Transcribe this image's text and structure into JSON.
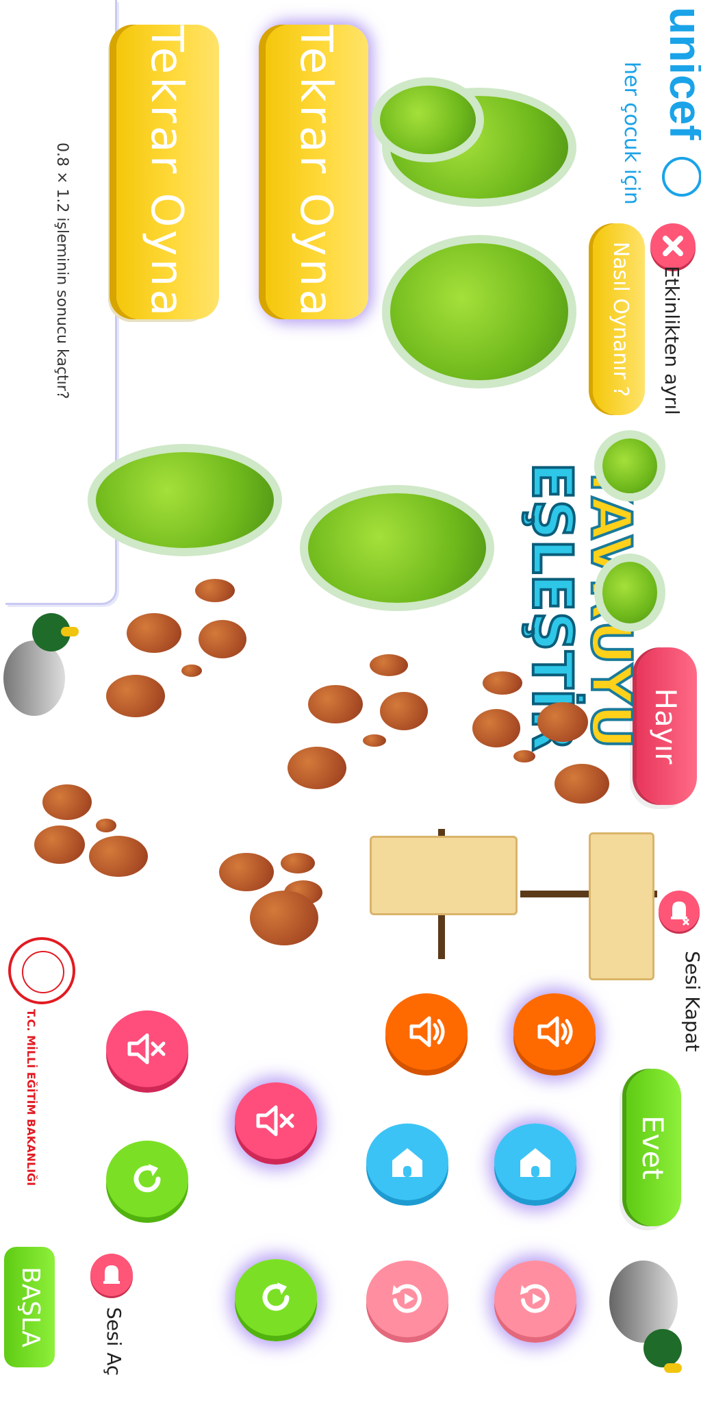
{
  "logos": {
    "unicef": "unicef",
    "unicef_tagline": "her çocuk için",
    "ministry": "T.C. MİLLİ EĞİTİM BAKANLIĞI"
  },
  "question": "0.8 × 1.2   işleminin sonucu kaçtır?",
  "buttons": {
    "tekrar_oyna_1": "Tekrar Oyna",
    "tekrar_oyna_2": "Tekrar Oyna",
    "nasil_oynanir": "Nasıl Oynanır ?",
    "hayir": "Hayır",
    "evet": "Evet",
    "basla": "BAŞLA"
  },
  "labels": {
    "exit": "Etkinlikten ayrıl",
    "sound_off": "Sesi Kapat",
    "sound_on": "Sesi Aç"
  },
  "title": {
    "line1": "YAVRUYU",
    "line2": "EŞLEŞTİR"
  },
  "icons": {
    "close": "close-icon",
    "mute": "mute-icon",
    "speaker": "speaker-icon",
    "home": "home-icon",
    "refresh": "refresh-icon",
    "replay": "replay-icon",
    "bell": "bell-icon"
  },
  "colors": {
    "yellow": "#ffd93a",
    "pink": "#ff5577",
    "green": "#7be025",
    "orange": "#ff6a00",
    "blue": "#3cc3f5",
    "lightpink": "#ff8fa0",
    "purple_glow": "#7d55eb"
  }
}
